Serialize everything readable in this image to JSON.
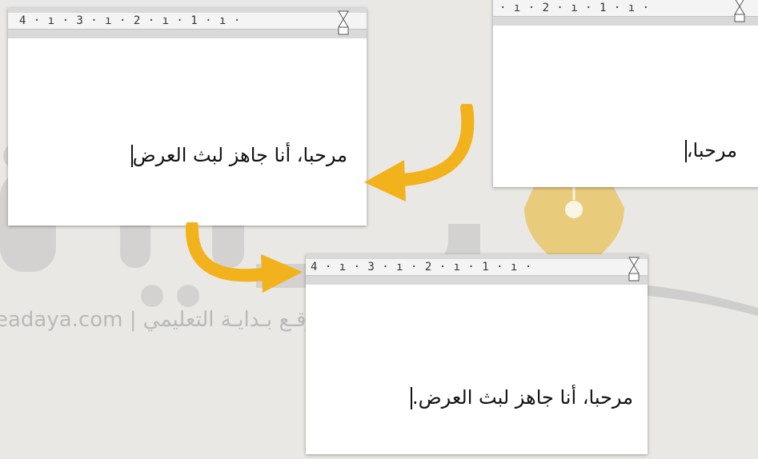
{
  "panels": {
    "top_left": {
      "ruler_numbers": "4 · ı · 3 · ı · 2 · ı · 1 · ı · ",
      "text": "مرحبا، أنا جاهز لبث العرض"
    },
    "top_right": {
      "ruler_numbers": "· ı · 2 · ı · 1 · ı · ",
      "text": "مرحبا،"
    },
    "bottom": {
      "ruler_numbers": "4 · ı · 3 · ı · 2 · ı · 1 · ı · ",
      "text": "مرحبا، أنا جاهز لبث العرض."
    }
  },
  "watermark": {
    "brand": "بداية",
    "line": "eadaya.com | موقـع بـدايـة التعليمي"
  },
  "colors": {
    "arrow": "#f2b21c",
    "watermark_gray": "#b9b9b9",
    "pen_gold": "#e9c56a"
  }
}
